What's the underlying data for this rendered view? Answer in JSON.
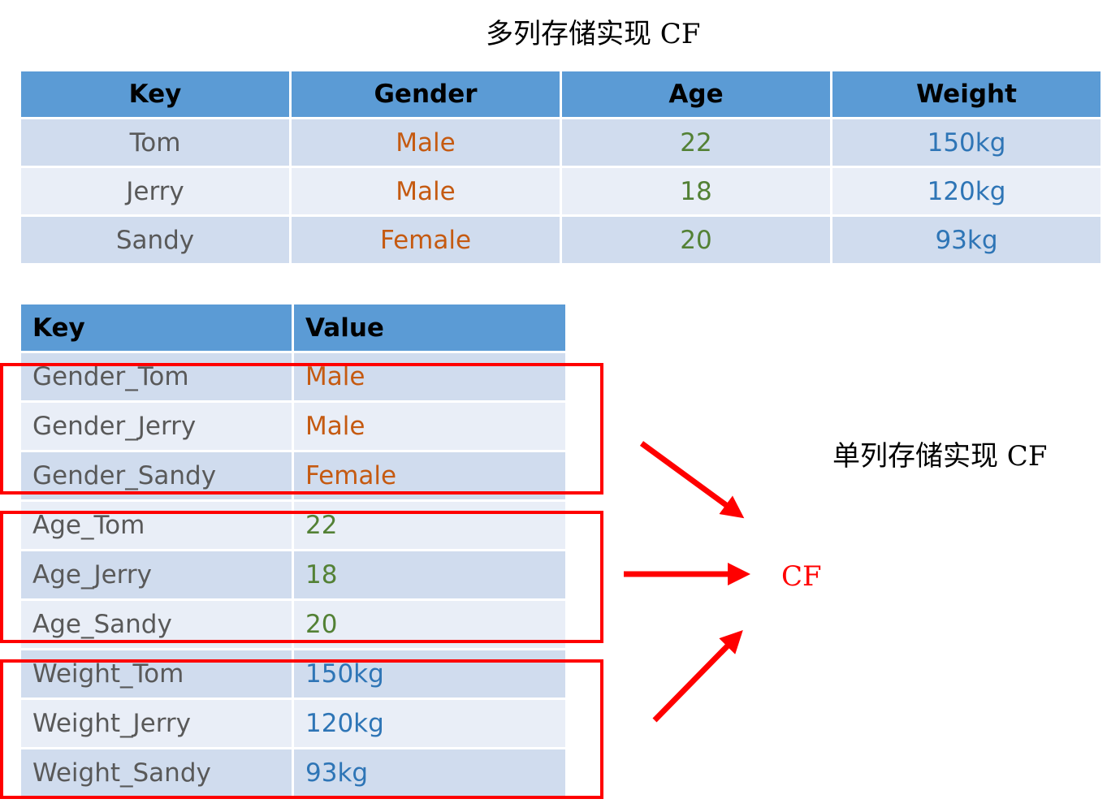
{
  "title_multi": "多列存储实现 CF",
  "title_single": "单列存储实现 CF",
  "cf_label": "CF",
  "multi_table": {
    "headers": [
      "Key",
      "Gender",
      "Age",
      "Weight"
    ],
    "rows": [
      [
        "Tom",
        "Male",
        "22",
        "150kg"
      ],
      [
        "Jerry",
        "Male",
        "18",
        "120kg"
      ],
      [
        "Sandy",
        "Female",
        "20",
        "93kg"
      ]
    ]
  },
  "single_table": {
    "headers": [
      "Key",
      "Value"
    ],
    "rows": [
      [
        "Gender_Tom",
        "Male"
      ],
      [
        "Gender_Jerry",
        "Male"
      ],
      [
        "Gender_Sandy",
        "Female"
      ],
      [
        "Age_Tom",
        "22"
      ],
      [
        "Age_Jerry",
        "18"
      ],
      [
        "Age_Sandy",
        "20"
      ],
      [
        "Weight_Tom",
        "150kg"
      ],
      [
        "Weight_Jerry",
        "120kg"
      ],
      [
        "Weight_Sandy",
        "93kg"
      ]
    ]
  },
  "colors": {
    "header": "#5b9bd5",
    "row_odd": "#d0dcee",
    "row_even": "#e9eef7",
    "gender": "#c55a11",
    "age": "#538135",
    "weight": "#2e75b6",
    "highlight": "#ff0000"
  }
}
